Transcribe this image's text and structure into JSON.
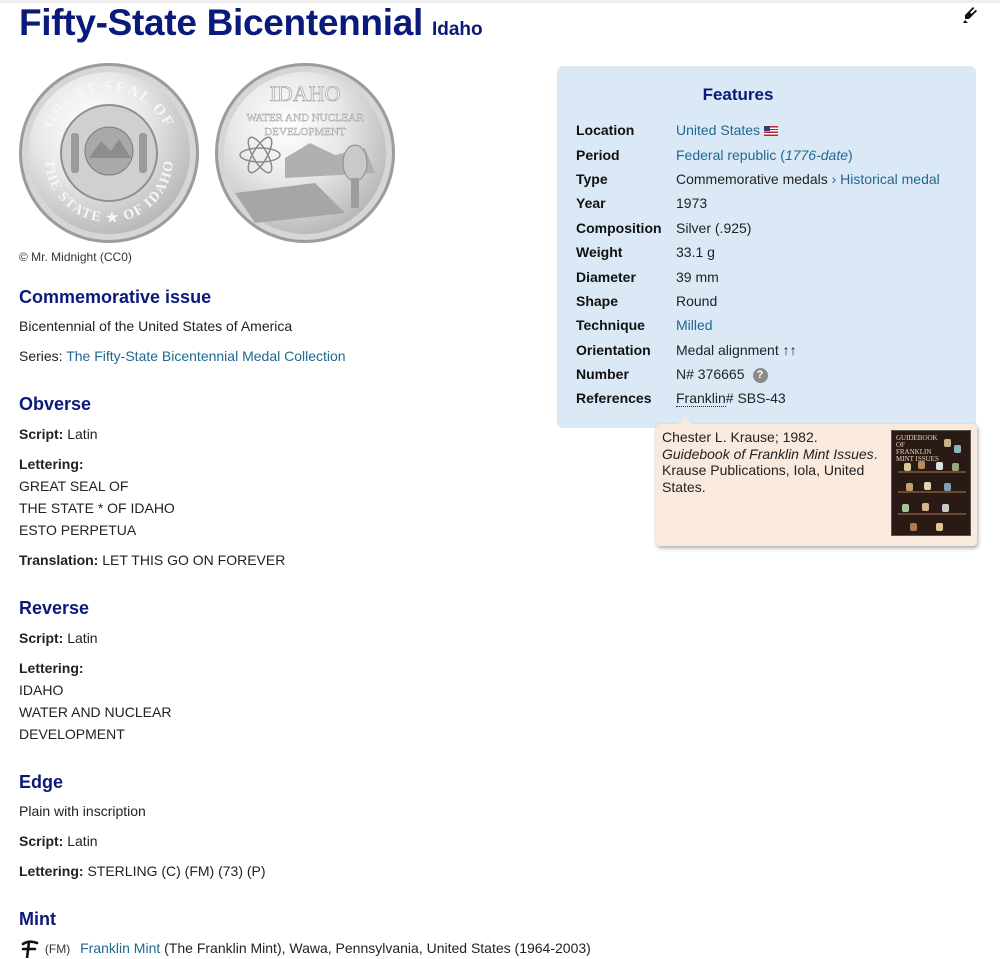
{
  "header": {
    "title": "Fifty-State Bicentennial",
    "subtitle": "Idaho",
    "edit_icon": "pencil-icon"
  },
  "images": {
    "credit": "© Mr. Midnight (CC0)",
    "obverse_text_top": "GREAT SEAL OF",
    "obverse_text_bottom": "THE STATE ★ OF IDAHO",
    "reverse_text_1": "IDAHO",
    "reverse_text_2": "WATER AND NUCLEAR",
    "reverse_text_3": "DEVELOPMENT"
  },
  "commemorative": {
    "heading": "Commemorative issue",
    "event": "Bicentennial of the United States of America",
    "series_label": "Series:",
    "series_link": "The Fifty-State Bicentennial Medal Collection"
  },
  "obverse": {
    "heading": "Obverse",
    "script_label": "Script:",
    "script": "Latin",
    "lettering_label": "Lettering:",
    "lettering": [
      "GREAT SEAL OF",
      "THE STATE * OF IDAHO",
      "ESTO PERPETUA"
    ],
    "translation_label": "Translation:",
    "translation": "LET THIS GO ON FOREVER"
  },
  "reverse": {
    "heading": "Reverse",
    "script_label": "Script:",
    "script": "Latin",
    "lettering_label": "Lettering:",
    "lettering": [
      "IDAHO",
      "WATER AND NUCLEAR",
      "DEVELOPMENT"
    ]
  },
  "edge": {
    "heading": "Edge",
    "description": "Plain with inscription",
    "script_label": "Script:",
    "script": "Latin",
    "lettering_label": "Lettering:",
    "lettering": "STERLING (C) (FM) (73) (P)"
  },
  "mint": {
    "heading": "Mint",
    "mark": "(FM)",
    "name_link": "Franklin Mint",
    "detail": "(The Franklin Mint), Wawa, Pennsylvania, United States (1964-2003)"
  },
  "features": {
    "heading": "Features",
    "rows": {
      "location": {
        "label": "Location",
        "value": "United States"
      },
      "period": {
        "label": "Period",
        "value_link": "Federal republic (",
        "value_italic": "1776-date",
        "value_end": ")"
      },
      "type": {
        "label": "Type",
        "value": "Commemorative medals",
        "sep": " › ",
        "value_link": "Historical medal"
      },
      "year": {
        "label": "Year",
        "value": "1973"
      },
      "composition": {
        "label": "Composition",
        "value": "Silver (.925)"
      },
      "weight": {
        "label": "Weight",
        "value": "33.1 g"
      },
      "diameter": {
        "label": "Diameter",
        "value": "39 mm"
      },
      "shape": {
        "label": "Shape",
        "value": "Round"
      },
      "technique": {
        "label": "Technique",
        "value_link": "Milled"
      },
      "orientation": {
        "label": "Orientation",
        "value": "Medal alignment ↑↑"
      },
      "number": {
        "label": "Number",
        "value": "N# 376665"
      },
      "references": {
        "label": "References",
        "value_link": "Franklin",
        "value": "# SBS-43"
      }
    }
  },
  "tooltip": {
    "author": "Chester L. Krause; 1982.",
    "book_title": "Guidebook of Franklin Mint Issues",
    "period_after_title": ".",
    "publisher": "Krause Publications, Iola, United States.",
    "cover_title": "GUIDEBOOK OF FRANKLIN MINT ISSUES"
  }
}
